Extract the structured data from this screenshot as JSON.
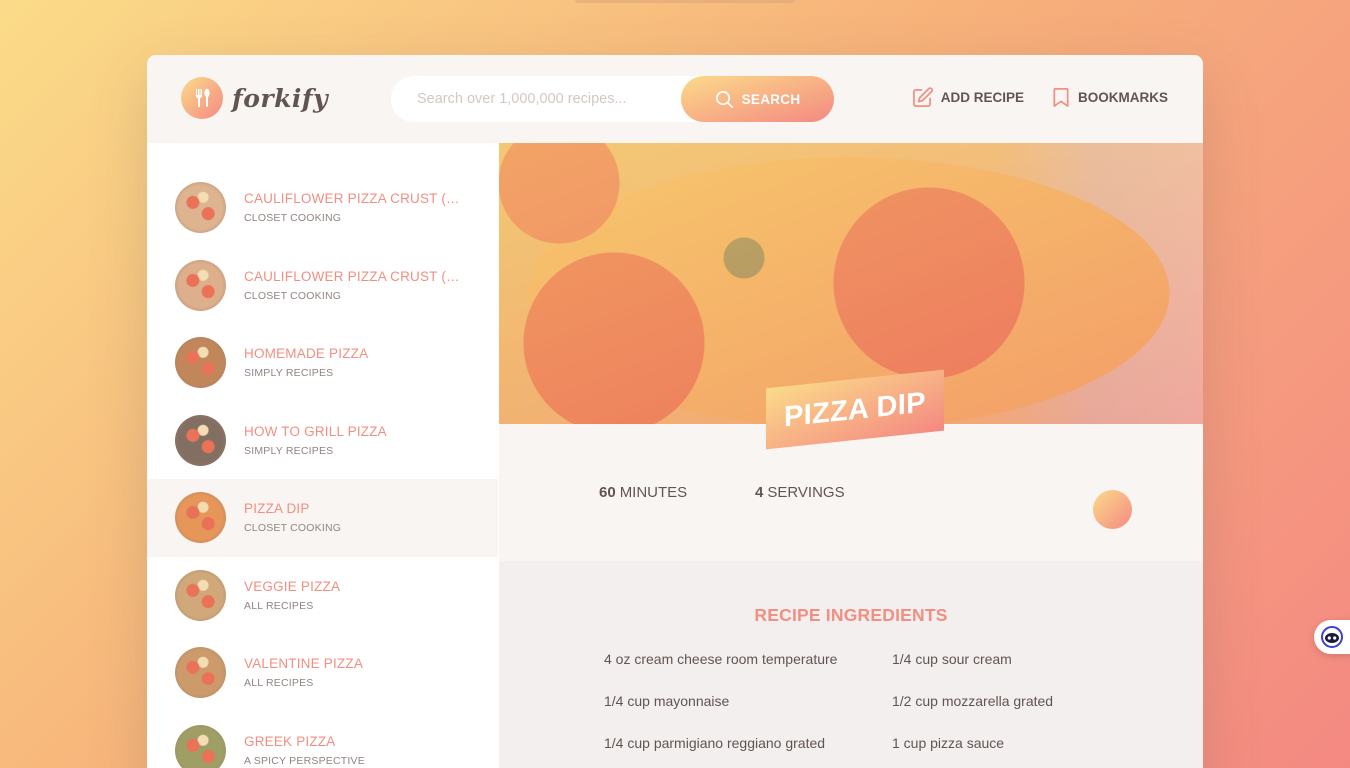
{
  "app": {
    "logo_text": "forkify",
    "logo_icon": "fork-knife-icon"
  },
  "search": {
    "placeholder": "Search over 1,000,000 recipes...",
    "value": "",
    "button_label": "SEARCH"
  },
  "nav": {
    "add_recipe": "ADD RECIPE",
    "bookmarks": "BOOKMARKS"
  },
  "results": [
    {
      "title": "CAULIFLOWER PIZZA CRUST (WIT...",
      "publisher": "CLOSET COOKING",
      "active": false,
      "thumb_color": "#d9a77d"
    },
    {
      "title": "CAULIFLOWER PIZZA CRUST (WIT...",
      "publisher": "CLOSET COOKING",
      "active": false,
      "thumb_color": "#d8a27a"
    },
    {
      "title": "HOMEMADE PIZZA",
      "publisher": "SIMPLY RECIPES",
      "active": false,
      "thumb_color": "#b8713f"
    },
    {
      "title": "HOW TO GRILL PIZZA",
      "publisher": "SIMPLY RECIPES",
      "active": false,
      "thumb_color": "#6e5646"
    },
    {
      "title": "PIZZA DIP",
      "publisher": "CLOSET COOKING",
      "active": true,
      "thumb_color": "#e3863f"
    },
    {
      "title": "VEGGIE PIZZA",
      "publisher": "ALL RECIPES",
      "active": false,
      "thumb_color": "#c99a63"
    },
    {
      "title": "VALENTINE PIZZA",
      "publisher": "ALL RECIPES",
      "active": false,
      "thumb_color": "#c58a52"
    },
    {
      "title": "GREEK PIZZA",
      "publisher": "A SPICY PERSPECTIVE",
      "active": false,
      "thumb_color": "#8f8f4b"
    }
  ],
  "recipe": {
    "title": "PIZZA DIP",
    "minutes": "60",
    "minutes_label": "MINUTES",
    "servings": "4",
    "servings_label": "SERVINGS",
    "ingredients_heading": "RECIPE INGREDIENTS",
    "ingredients": [
      "4 oz cream cheese room temperature",
      "1/4 cup sour cream",
      "1/4 cup mayonnaise",
      "1/2 cup mozzarella grated",
      "1/4 cup parmigiano reggiano grated",
      "1 cup pizza sauce"
    ]
  },
  "colors": {
    "accent": "#f38e82",
    "gradient_start": "#fbdb89",
    "gradient_end": "#f48982",
    "text": "#615551",
    "light_bg": "#f9f5f3"
  }
}
